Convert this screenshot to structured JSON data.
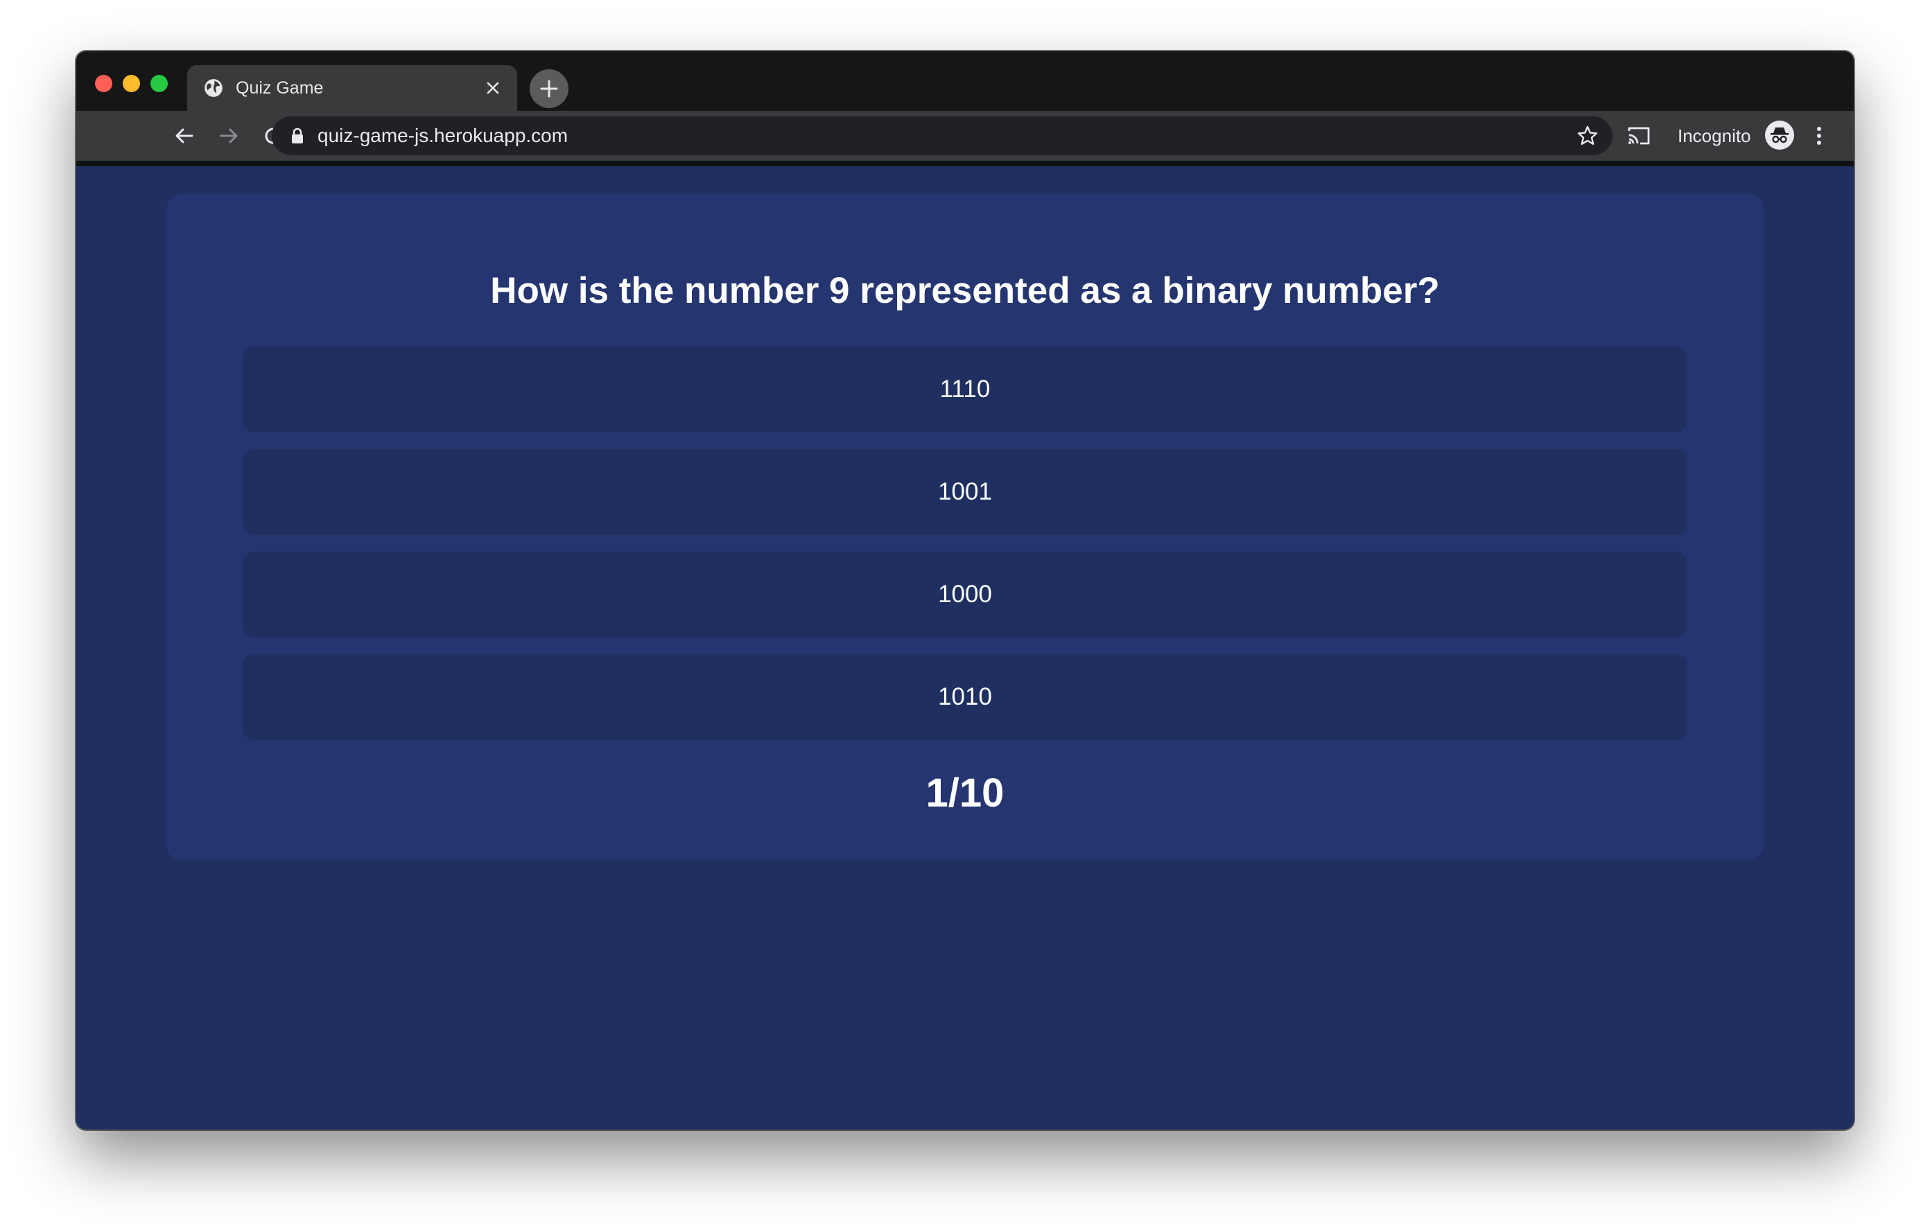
{
  "browser": {
    "tab": {
      "title": "Quiz Game",
      "favicon": "globe-icon"
    },
    "url": "quiz-game-js.herokuapp.com",
    "profile_label": "Incognito"
  },
  "quiz": {
    "question": "How is the number 9 represented as a binary number?",
    "answers": [
      {
        "label": "1110"
      },
      {
        "label": "1001"
      },
      {
        "label": "1000"
      },
      {
        "label": "1010"
      }
    ],
    "progress": "1/10"
  },
  "colors": {
    "page_background": "#1f2f60",
    "card_background": "#253570",
    "answer_background": "#1f2f60",
    "text": "#ffffff"
  }
}
